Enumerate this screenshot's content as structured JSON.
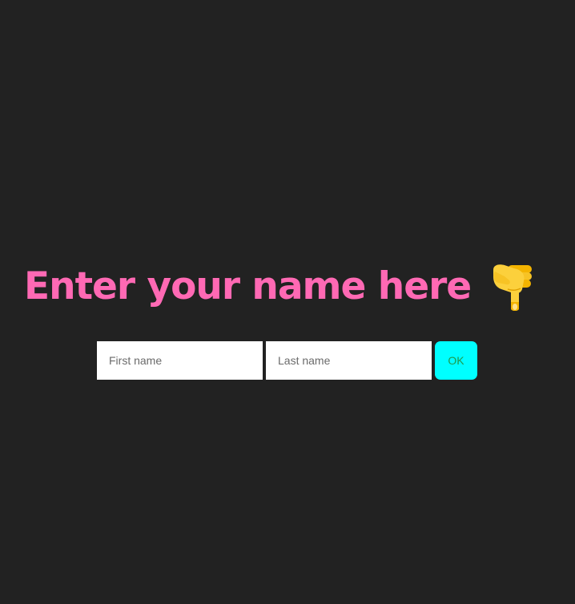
{
  "page": {
    "background_color": "#222222"
  },
  "heading": {
    "text": "Enter your name here",
    "color": "#ff69b4",
    "icon": "backhand-index-pointing-down-icon"
  },
  "form": {
    "first_name": {
      "placeholder": "First name",
      "value": ""
    },
    "last_name": {
      "placeholder": "Last name",
      "value": ""
    },
    "submit": {
      "label": "OK",
      "background_color": "#00ffff",
      "text_color": "#1f9a4a"
    }
  }
}
